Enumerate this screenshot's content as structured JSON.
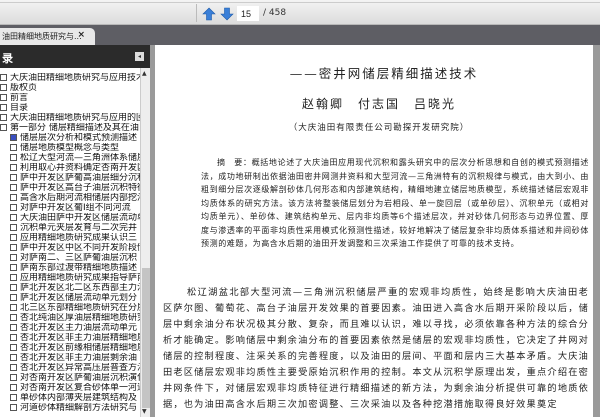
{
  "toolbar": {
    "page_current": "15",
    "page_total": "/ 458",
    "prev_label": "previous-page",
    "next_label": "next-page"
  },
  "tab": {
    "title": "油田精细地质研究与...",
    "close": "×"
  },
  "sidebar": {
    "title": "录",
    "collapse": "◂",
    "items": [
      {
        "label": "大庆油田精细地质研究与应用技术",
        "level": 1
      },
      {
        "label": "版权页",
        "level": 1
      },
      {
        "label": "前言",
        "level": 1
      },
      {
        "label": "目录",
        "level": 1
      },
      {
        "label": "大庆油田精细地质研究与应用的回顾",
        "level": 1
      },
      {
        "label": "第一部分  储层精细描述及其在油",
        "level": 1
      },
      {
        "label": "储层层次分析和模式预测描述",
        "level": 2,
        "selected": true
      },
      {
        "label": "储层地质模型概念与类型",
        "level": 2
      },
      {
        "label": "松辽大型河流—三角洲体系储层",
        "level": 2
      },
      {
        "label": "利用取心井资料确定杏南开发区",
        "level": 2
      },
      {
        "label": "萨中开发区萨葡高油层细分沉积",
        "level": 2
      },
      {
        "label": "萨中开发区高台子油层沉积特征",
        "level": 2
      },
      {
        "label": "高含水后期河流相储层内部挖潜",
        "level": 2
      },
      {
        "label": "对萨中开发区葡Ⅰ组不同河流",
        "level": 2
      },
      {
        "label": "大庆油田萨中开发区储层流动单",
        "level": 2
      },
      {
        "label": "沉积单元夹层发育与二次完井",
        "level": 2
      },
      {
        "label": "应用精细地质研究成果认识三",
        "level": 2
      },
      {
        "label": "萨中开发区中区不同开发阶段储",
        "level": 2
      },
      {
        "label": "对萨南二、三区萨葡油层沉积",
        "level": 2
      },
      {
        "label": "萨南东部过渡带精细地质描述",
        "level": 2
      },
      {
        "label": "应用精细地质研究成果指导萨南",
        "level": 2
      },
      {
        "label": "萨北开发区北二区东西部主力油",
        "level": 2
      },
      {
        "label": "萨北开发区储层流动单元划分",
        "level": 2
      },
      {
        "label": "北三区东部精细地质研究在分层",
        "level": 2
      },
      {
        "label": "杏北纯油区厚油层精细地质研究",
        "level": 2
      },
      {
        "label": "杏北开发区主力油层流动单元",
        "level": 2
      },
      {
        "label": "杏北开发区非主力油层精细地质",
        "level": 2
      },
      {
        "label": "杏北开发区前缘相储层精细地质",
        "level": 2
      },
      {
        "label": "杏北开发区非主力油层剩余油",
        "level": 2
      },
      {
        "label": "杏北开发区异常高压层普查方法",
        "level": 2
      },
      {
        "label": "对杏南开发区萨葡油层沉积演化",
        "level": 2
      },
      {
        "label": "对杏南开发区复合砂体单一河道",
        "level": 2
      },
      {
        "label": "单砂体内部薄夹层建筑结构及",
        "level": 2
      },
      {
        "label": "河道砂体精细解剖方法研究与",
        "level": 2
      }
    ]
  },
  "document": {
    "title": "——密井网储层精细描述技术",
    "authors": "赵翰卿　付志国　吕晓光",
    "affiliation": "（大庆油田有限责任公司勘探开发研究院）",
    "abstract": "摘　要：概括地论述了大庆油田应用现代沉积和露头研究中的层次分析思想和自创的模式预测描述法，成功地研制出依据油田密井网测井资料和大型河流—三角洲特有的沉积规律与模式，由大到小、由粗到细分层次逐级解剖砂体几何形态和内部建筑结构，精细地建立储层地质模型，系统描述储层宏观非均质体系的研究方法。该方法将整装储层划分为岩相段、单一旋回层（或单砂层）、沉积单元（或相对均质单元）、单砂体、建筑结构单元、层内非均质等6个描述层次，并对砂体几何形态与边界位置、厚度与渗透率的平面非均质性采用模式化预测性描述，较好地解决了储层复杂非均质体系描述和井间砂体预测的难题，为高含水后期的油田开发调整和三次采油工作提供了可靠的技术支持。",
    "body": "松辽湖盆北部大型河流—三角洲沉积储层严重的宏观非均质性，始终是影响大庆油田老区萨尔图、葡萄花、高台子油层开发效果的首要因素。油田进入高含水后期开采阶段以后，储层中剩余油分布状况极其分散、复杂，而且难以认识，难以寻找，必须依靠各种方法的综合分析才能确定。影响储层中剩余油分布的首要因素依然是储层的宏观非均质性，它决定了井网对储层的控制程度、注采关系的完善程度，以及油田的层间、平面和层内三大基本矛盾。大庆油田老区储层宏观非均质性主要受原始沉积作用的控制。本文从沉积学原理出发，重点介绍在密井网条件下，对储层宏观非均质特征进行精细描述的新方法，为剩余油分析提供可靠的地质依据，也为油田高含水后期三次加密调整、三次采油以及各种挖潜措施取得良好效果奠定"
  }
}
